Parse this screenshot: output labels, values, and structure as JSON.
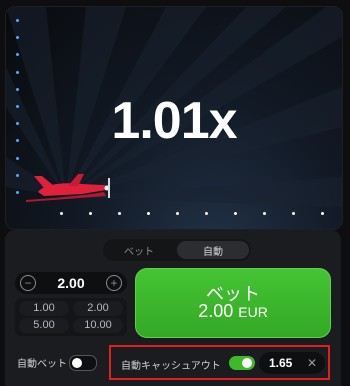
{
  "game": {
    "multiplier": "1.01x",
    "accent_color": "#e0213c"
  },
  "panel": {
    "tabs": [
      {
        "label": "ベット",
        "active": false
      },
      {
        "label": "自動",
        "active": true
      }
    ],
    "stake": "2.00",
    "quick_amounts": [
      "1.00",
      "2.00",
      "5.00",
      "10.00"
    ],
    "bet_button": {
      "label": "ベット",
      "amount": "2.00",
      "currency": "EUR",
      "color": "#3fb82c"
    },
    "auto_bet": {
      "label": "自動ベット",
      "enabled": false
    },
    "auto_cashout": {
      "label": "自動キャッシュアウト",
      "enabled": true,
      "value": "1.65",
      "clear_icon": "close-icon"
    }
  }
}
